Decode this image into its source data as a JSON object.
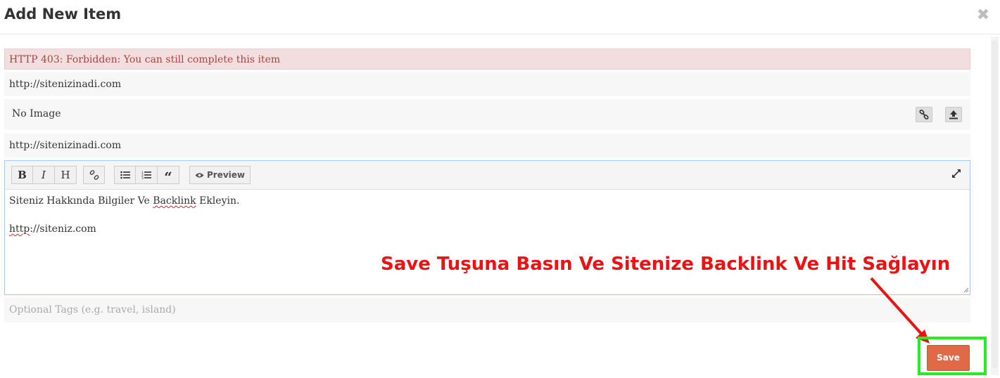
{
  "modal": {
    "title": "Add New Item",
    "close_icon": "close-icon"
  },
  "alert": {
    "message": "HTTP 403: Forbidden: You can still complete this item"
  },
  "form": {
    "url_value": "http://sitenizinadi.com",
    "image_label": "No Image",
    "image_link_icon": "link-icon",
    "image_upload_icon": "upload-icon",
    "url2_value": "http://sitenizinadi.com",
    "tags_placeholder": "Optional Tags (e.g. travel, island)"
  },
  "editor": {
    "toolbar": {
      "bold": "B",
      "italic": "I",
      "heading": "H",
      "link_icon": "link-icon",
      "ul_icon": "bulleted-list-icon",
      "ol_icon": "numbered-list-icon",
      "quote_icon": "quote-icon",
      "preview_label": "Preview",
      "preview_icon": "eye-icon",
      "expand_icon": "fullscreen-icon"
    },
    "content": {
      "line1_before": "Siteniz Hakkında Bilgiler Ve ",
      "line1_misspelled": "Backlink",
      "line1_after": " Ekleyin.",
      "line2_misspelled": "http",
      "line2_after": "://siteniz.com"
    }
  },
  "annotation": {
    "text": "Save Tuşuna Basın Ve Sitenize Backlink Ve Hit Sağlayın",
    "color": "#ee1111",
    "highlight_color": "#22ee22"
  },
  "footer": {
    "save_label": "Save",
    "save_color": "#e06a47"
  }
}
